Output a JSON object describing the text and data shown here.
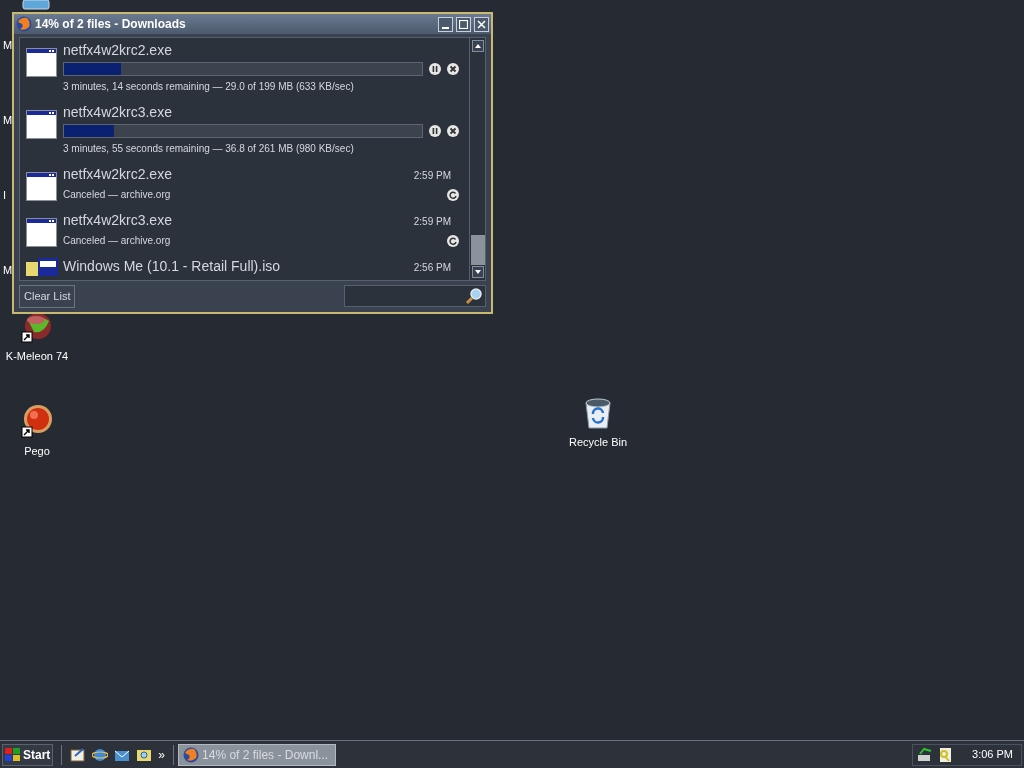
{
  "desktop_icons_left": [
    {
      "label": "M"
    },
    {
      "label": "M"
    },
    {
      "label": "I"
    },
    {
      "label": "M"
    }
  ],
  "desktop_icons": [
    {
      "label": "K-Meleon 74",
      "kind": "melon"
    },
    {
      "label": "Pego",
      "kind": "ball"
    }
  ],
  "recycle_bin": {
    "label": "Recycle Bin"
  },
  "window": {
    "title": "14% of 2 files - Downloads"
  },
  "downloads": [
    {
      "kind": "active",
      "name": "netfx4w2krc2.exe",
      "level": 0.16,
      "status": "3 minutes, 14 seconds remaining — 29.0 of 199 MB (633 KB/sec)"
    },
    {
      "kind": "active",
      "name": "netfx4w2krc3.exe",
      "level": 0.14,
      "status": "3 minutes, 55 seconds remaining — 36.8 of 261 MB (980 KB/sec)"
    },
    {
      "kind": "done",
      "name": "netfx4w2krc2.exe",
      "time": "2:59 PM",
      "status": "Canceled — archive.org"
    },
    {
      "kind": "done",
      "name": "netfx4w2krc3.exe",
      "time": "2:59 PM",
      "status": "Canceled — archive.org"
    },
    {
      "kind": "partial",
      "name": "Windows Me (10.1 - Retail Full).iso",
      "time": "2:56 PM"
    }
  ],
  "footer": {
    "button": "Clear List"
  },
  "taskbar": {
    "start": "Start",
    "chevron": "»",
    "task": "14% of 2 files - Downl...",
    "clock": "3:06 PM"
  }
}
